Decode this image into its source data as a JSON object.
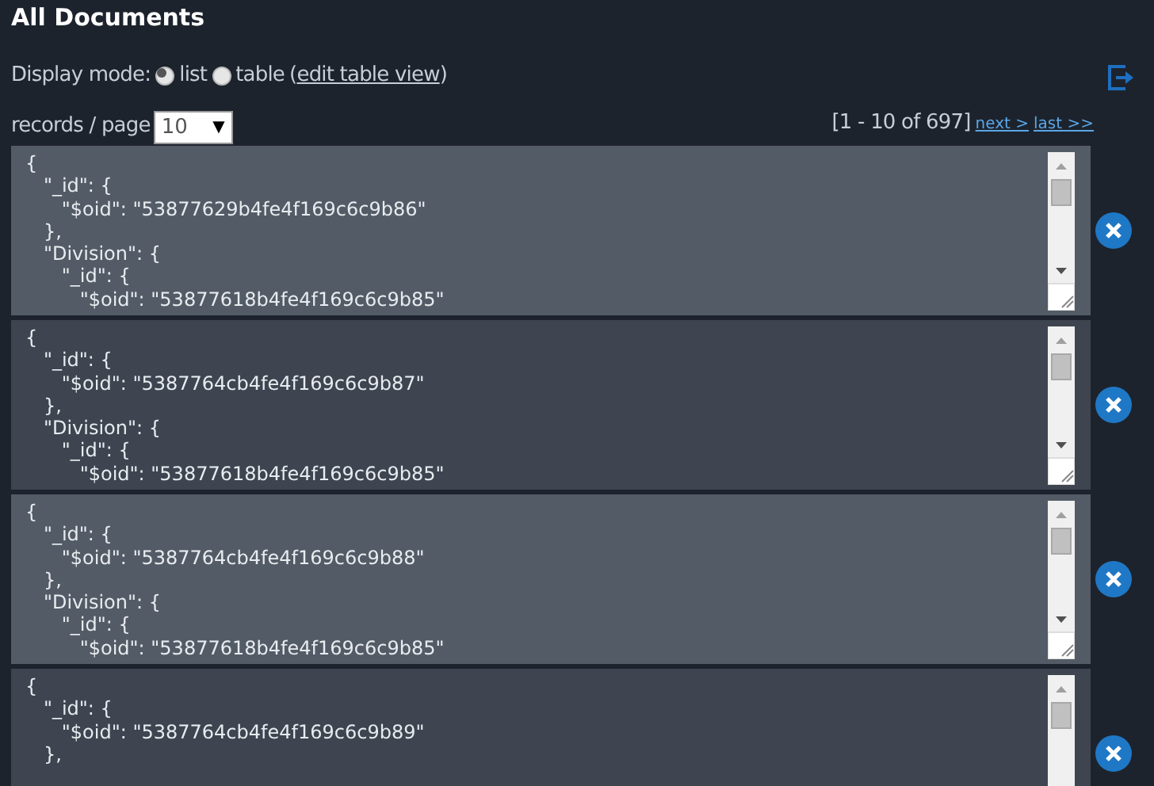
{
  "title": "All Documents",
  "display_mode": {
    "label": "Display mode:",
    "options": [
      {
        "label": "list",
        "selected": true
      },
      {
        "label": "table",
        "selected": false
      }
    ],
    "paren_open": "(",
    "link": "edit table view",
    "paren_close": ")"
  },
  "records_per_page": {
    "label": "records / page",
    "value": "10",
    "arrow": "▼"
  },
  "pagination": {
    "range": "[1 - 10 of 697]",
    "next": "next >",
    "last": "last >>"
  },
  "records": [
    {
      "text": "{\n   \"_id\": {\n      \"$oid\": \"53877629b4fe4f169c6c9b86\"\n   },\n   \"Division\": {\n      \"_id\": {\n         \"$oid\": \"53877618b4fe4f169c6c9b85\""
    },
    {
      "text": "{\n   \"_id\": {\n      \"$oid\": \"5387764cb4fe4f169c6c9b87\"\n   },\n   \"Division\": {\n      \"_id\": {\n         \"$oid\": \"53877618b4fe4f169c6c9b85\""
    },
    {
      "text": "{\n   \"_id\": {\n      \"$oid\": \"5387764cb4fe4f169c6c9b88\"\n   },\n   \"Division\": {\n      \"_id\": {\n         \"$oid\": \"53877618b4fe4f169c6c9b85\""
    },
    {
      "text": "{\n   \"_id\": {\n      \"$oid\": \"5387764cb4fe4f169c6c9b89\"\n   },"
    }
  ]
}
